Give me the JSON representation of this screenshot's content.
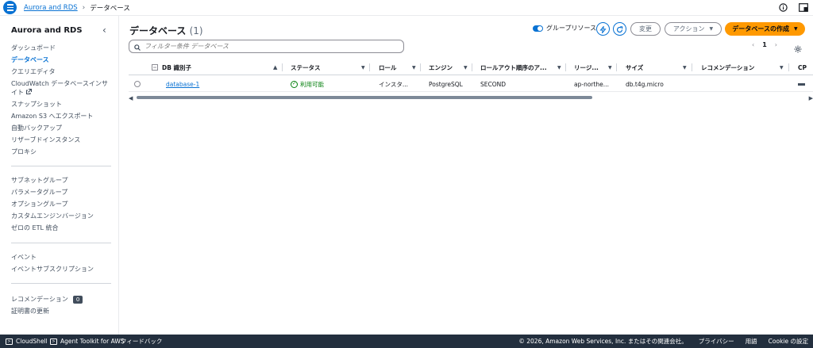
{
  "breadcrumb": {
    "root": "Aurora and RDS",
    "current": "データベース"
  },
  "sidebar": {
    "title": "Aurora and RDS",
    "group1": [
      "ダッシュボード",
      "データベース",
      "クエリエディタ",
      "CloudWatch データベースインサイト",
      "スナップショット",
      "Amazon S3 へエクスポート",
      "自動バックアップ",
      "リザーブドインスタンス",
      "プロキシ"
    ],
    "group2": [
      "サブネットグループ",
      "パラメータグループ",
      "オプショングループ",
      "カスタムエンジンバージョン",
      "ゼロの ETL 統合"
    ],
    "group3": [
      "イベント",
      "イベントサブスクリプション"
    ],
    "group4": {
      "recommend_label": "レコメンデーション",
      "recommend_count": "0",
      "cert_label": "証明書の更新"
    }
  },
  "header": {
    "title": "データベース",
    "count": "(1)",
    "group_resources_label": "グループリソース",
    "modify_label": "変更",
    "actions_label": "アクション",
    "create_label": "データベースの作成"
  },
  "search": {
    "placeholder": "フィルター条件 データベース"
  },
  "pagination": {
    "page": "1"
  },
  "table": {
    "columns": [
      "DB 識別子",
      "ステータス",
      "ロール",
      "エンジン",
      "ロールアウト順序のア...",
      "リージ...",
      "サイズ",
      "レコメンデーション",
      "CP"
    ],
    "rows": [
      {
        "id": "database-1",
        "status": "利用可能",
        "role": "インスタ...",
        "engine": "PostgreSQL",
        "rollout": "SECOND",
        "region": "ap-northe...",
        "size": "db.t4g.micro",
        "recommend": ""
      }
    ]
  },
  "footer": {
    "cloudshell": "CloudShell",
    "agent_toolkit": "Agent Toolkit for AWS",
    "feedback": "フィードバック",
    "copyright": "© 2026, Amazon Web Services, Inc. またはその関連会社。",
    "privacy": "プライバシー",
    "terms": "用語",
    "cookie": "Cookie の設定"
  },
  "colors": {
    "link": "#0972d3",
    "primary": "#ff9900",
    "success": "#037f0c",
    "footer_bg": "#232f3e"
  }
}
